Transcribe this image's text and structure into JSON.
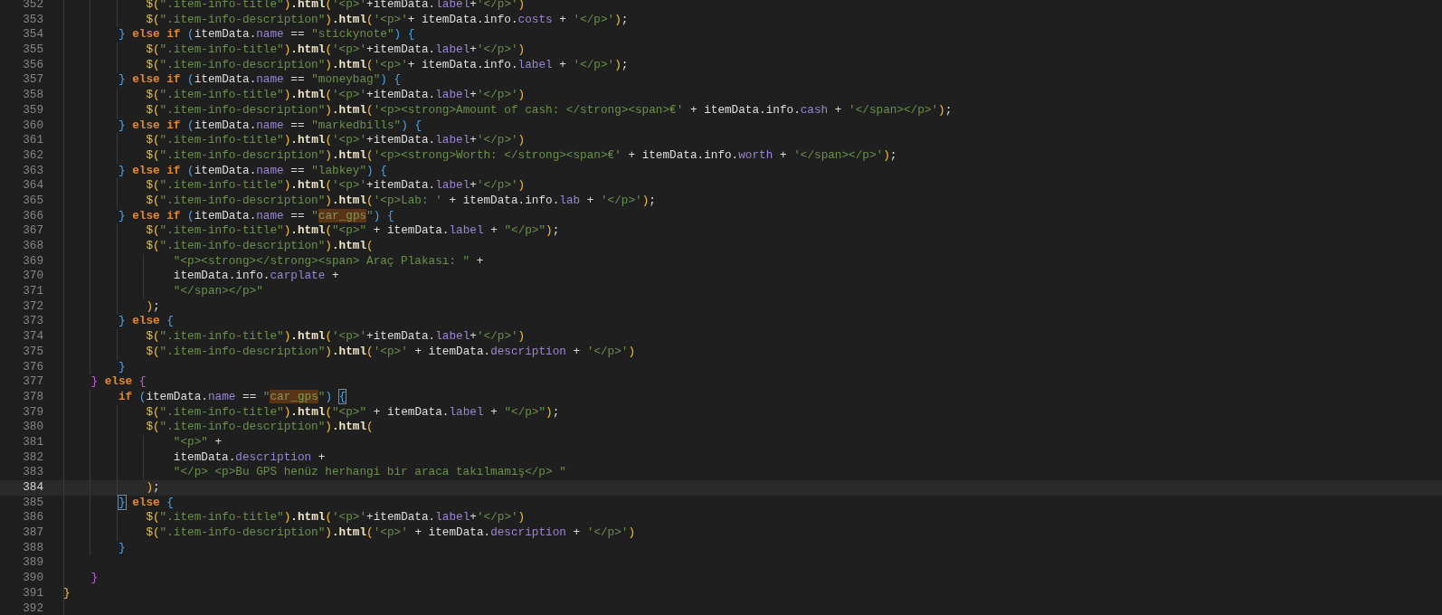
{
  "editor": {
    "lines": [
      {
        "number": "352",
        "current": false,
        "tokens": [
          {
            "text": "            $(",
            "kind": "paren"
          },
          {
            "text": "\".item-info-title\"",
            "kind": "string"
          },
          {
            "text": ")",
            "kind": "paren"
          },
          {
            "text": ".html",
            "kind": "method"
          },
          {
            "text": "(",
            "kind": "paren"
          },
          {
            "text": "'<p>'",
            "kind": "string"
          },
          {
            "text": "+itemData.",
            "kind": "plain"
          },
          {
            "text": "label",
            "kind": "property"
          },
          {
            "text": "+",
            "kind": "plain"
          },
          {
            "text": "'</p>'",
            "kind": "string"
          },
          {
            "text": ")",
            "kind": "paren"
          }
        ]
      },
      {
        "number": "353",
        "current": false,
        "tokens": [
          {
            "text": "            $(",
            "kind": "paren"
          },
          {
            "text": "\".item-info-description\"",
            "kind": "string"
          },
          {
            "text": ")",
            "kind": "paren"
          },
          {
            "text": ".html",
            "kind": "method"
          },
          {
            "text": "(",
            "kind": "paren"
          },
          {
            "text": "'<p>'",
            "kind": "string"
          },
          {
            "text": "+ itemData.info.",
            "kind": "plain"
          },
          {
            "text": "costs",
            "kind": "property"
          },
          {
            "text": " + ",
            "kind": "plain"
          },
          {
            "text": "'</p>'",
            "kind": "string"
          },
          {
            "text": ")",
            "kind": "paren"
          },
          {
            "text": ";",
            "kind": "plain"
          }
        ]
      },
      {
        "number": "354",
        "current": false,
        "tokens": [
          {
            "text": "        }",
            "kind": "brace3"
          },
          {
            "text": " else if ",
            "kind": "keyword"
          },
          {
            "text": "(",
            "kind": "brace3"
          },
          {
            "text": "itemData.",
            "kind": "plain"
          },
          {
            "text": "name",
            "kind": "property"
          },
          {
            "text": " == ",
            "kind": "plain"
          },
          {
            "text": "\"stickynote\"",
            "kind": "string"
          },
          {
            "text": ") {",
            "kind": "brace3"
          }
        ]
      },
      {
        "number": "355",
        "current": false,
        "tokens": [
          {
            "text": "            $(",
            "kind": "paren"
          },
          {
            "text": "\".item-info-title\"",
            "kind": "string"
          },
          {
            "text": ")",
            "kind": "paren"
          },
          {
            "text": ".html",
            "kind": "method"
          },
          {
            "text": "(",
            "kind": "paren"
          },
          {
            "text": "'<p>'",
            "kind": "string"
          },
          {
            "text": "+itemData.",
            "kind": "plain"
          },
          {
            "text": "label",
            "kind": "property"
          },
          {
            "text": "+",
            "kind": "plain"
          },
          {
            "text": "'</p>'",
            "kind": "string"
          },
          {
            "text": ")",
            "kind": "paren"
          }
        ]
      },
      {
        "number": "356",
        "current": false,
        "tokens": [
          {
            "text": "            $(",
            "kind": "paren"
          },
          {
            "text": "\".item-info-description\"",
            "kind": "string"
          },
          {
            "text": ")",
            "kind": "paren"
          },
          {
            "text": ".html",
            "kind": "method"
          },
          {
            "text": "(",
            "kind": "paren"
          },
          {
            "text": "'<p>'",
            "kind": "string"
          },
          {
            "text": "+ itemData.info.",
            "kind": "plain"
          },
          {
            "text": "label",
            "kind": "property"
          },
          {
            "text": " + ",
            "kind": "plain"
          },
          {
            "text": "'</p>'",
            "kind": "string"
          },
          {
            "text": ")",
            "kind": "paren"
          },
          {
            "text": ";",
            "kind": "plain"
          }
        ]
      },
      {
        "number": "357",
        "current": false,
        "tokens": [
          {
            "text": "        }",
            "kind": "brace3"
          },
          {
            "text": " else if ",
            "kind": "keyword"
          },
          {
            "text": "(",
            "kind": "brace3"
          },
          {
            "text": "itemData.",
            "kind": "plain"
          },
          {
            "text": "name",
            "kind": "property"
          },
          {
            "text": " == ",
            "kind": "plain"
          },
          {
            "text": "\"moneybag\"",
            "kind": "string"
          },
          {
            "text": ") {",
            "kind": "brace3"
          }
        ]
      },
      {
        "number": "358",
        "current": false,
        "tokens": [
          {
            "text": "            $(",
            "kind": "paren"
          },
          {
            "text": "\".item-info-title\"",
            "kind": "string"
          },
          {
            "text": ")",
            "kind": "paren"
          },
          {
            "text": ".html",
            "kind": "method"
          },
          {
            "text": "(",
            "kind": "paren"
          },
          {
            "text": "'<p>'",
            "kind": "string"
          },
          {
            "text": "+itemData.",
            "kind": "plain"
          },
          {
            "text": "label",
            "kind": "property"
          },
          {
            "text": "+",
            "kind": "plain"
          },
          {
            "text": "'</p>'",
            "kind": "string"
          },
          {
            "text": ")",
            "kind": "paren"
          }
        ]
      },
      {
        "number": "359",
        "current": false,
        "tokens": [
          {
            "text": "            $(",
            "kind": "paren"
          },
          {
            "text": "\".item-info-description\"",
            "kind": "string"
          },
          {
            "text": ")",
            "kind": "paren"
          },
          {
            "text": ".html",
            "kind": "method"
          },
          {
            "text": "(",
            "kind": "paren"
          },
          {
            "text": "'<p><strong>Amount of cash: </strong><span>€'",
            "kind": "string"
          },
          {
            "text": " + itemData.info.",
            "kind": "plain"
          },
          {
            "text": "cash",
            "kind": "property"
          },
          {
            "text": " + ",
            "kind": "plain"
          },
          {
            "text": "'</span></p>'",
            "kind": "string"
          },
          {
            "text": ")",
            "kind": "paren"
          },
          {
            "text": ";",
            "kind": "plain"
          }
        ]
      },
      {
        "number": "360",
        "current": false,
        "tokens": [
          {
            "text": "        }",
            "kind": "brace3"
          },
          {
            "text": " else if ",
            "kind": "keyword"
          },
          {
            "text": "(",
            "kind": "brace3"
          },
          {
            "text": "itemData.",
            "kind": "plain"
          },
          {
            "text": "name",
            "kind": "property"
          },
          {
            "text": " == ",
            "kind": "plain"
          },
          {
            "text": "\"markedbills\"",
            "kind": "string"
          },
          {
            "text": ") {",
            "kind": "brace3"
          }
        ]
      },
      {
        "number": "361",
        "current": false,
        "tokens": [
          {
            "text": "            $(",
            "kind": "paren"
          },
          {
            "text": "\".item-info-title\"",
            "kind": "string"
          },
          {
            "text": ")",
            "kind": "paren"
          },
          {
            "text": ".html",
            "kind": "method"
          },
          {
            "text": "(",
            "kind": "paren"
          },
          {
            "text": "'<p>'",
            "kind": "string"
          },
          {
            "text": "+itemData.",
            "kind": "plain"
          },
          {
            "text": "label",
            "kind": "property"
          },
          {
            "text": "+",
            "kind": "plain"
          },
          {
            "text": "'</p>'",
            "kind": "string"
          },
          {
            "text": ")",
            "kind": "paren"
          }
        ]
      },
      {
        "number": "362",
        "current": false,
        "tokens": [
          {
            "text": "            $(",
            "kind": "paren"
          },
          {
            "text": "\".item-info-description\"",
            "kind": "string"
          },
          {
            "text": ")",
            "kind": "paren"
          },
          {
            "text": ".html",
            "kind": "method"
          },
          {
            "text": "(",
            "kind": "paren"
          },
          {
            "text": "'<p><strong>Worth: </strong><span>€'",
            "kind": "string"
          },
          {
            "text": " + itemData.info.",
            "kind": "plain"
          },
          {
            "text": "worth",
            "kind": "property"
          },
          {
            "text": " + ",
            "kind": "plain"
          },
          {
            "text": "'</span></p>'",
            "kind": "string"
          },
          {
            "text": ")",
            "kind": "paren"
          },
          {
            "text": ";",
            "kind": "plain"
          }
        ]
      },
      {
        "number": "363",
        "current": false,
        "tokens": [
          {
            "text": "        }",
            "kind": "brace3"
          },
          {
            "text": " else if ",
            "kind": "keyword"
          },
          {
            "text": "(",
            "kind": "brace3"
          },
          {
            "text": "itemData.",
            "kind": "plain"
          },
          {
            "text": "name",
            "kind": "property"
          },
          {
            "text": " == ",
            "kind": "plain"
          },
          {
            "text": "\"labkey\"",
            "kind": "string"
          },
          {
            "text": ") {",
            "kind": "brace3"
          }
        ]
      },
      {
        "number": "364",
        "current": false,
        "tokens": [
          {
            "text": "            $(",
            "kind": "paren"
          },
          {
            "text": "\".item-info-title\"",
            "kind": "string"
          },
          {
            "text": ")",
            "kind": "paren"
          },
          {
            "text": ".html",
            "kind": "method"
          },
          {
            "text": "(",
            "kind": "paren"
          },
          {
            "text": "'<p>'",
            "kind": "string"
          },
          {
            "text": "+itemData.",
            "kind": "plain"
          },
          {
            "text": "label",
            "kind": "property"
          },
          {
            "text": "+",
            "kind": "plain"
          },
          {
            "text": "'</p>'",
            "kind": "string"
          },
          {
            "text": ")",
            "kind": "paren"
          }
        ]
      },
      {
        "number": "365",
        "current": false,
        "tokens": [
          {
            "text": "            $(",
            "kind": "paren"
          },
          {
            "text": "\".item-info-description\"",
            "kind": "string"
          },
          {
            "text": ")",
            "kind": "paren"
          },
          {
            "text": ".html",
            "kind": "method"
          },
          {
            "text": "(",
            "kind": "paren"
          },
          {
            "text": "'<p>Lab: '",
            "kind": "string"
          },
          {
            "text": " + itemData.info.",
            "kind": "plain"
          },
          {
            "text": "lab",
            "kind": "property"
          },
          {
            "text": " + ",
            "kind": "plain"
          },
          {
            "text": "'</p>'",
            "kind": "string"
          },
          {
            "text": ")",
            "kind": "paren"
          },
          {
            "text": ";",
            "kind": "plain"
          }
        ]
      },
      {
        "number": "366",
        "current": false,
        "tokens": [
          {
            "text": "        }",
            "kind": "brace3"
          },
          {
            "text": " else if ",
            "kind": "keyword"
          },
          {
            "text": "(",
            "kind": "brace3"
          },
          {
            "text": "itemData.",
            "kind": "plain"
          },
          {
            "text": "name",
            "kind": "property"
          },
          {
            "text": " == ",
            "kind": "plain"
          },
          {
            "text": "\"",
            "kind": "string"
          },
          {
            "text": "car_gps",
            "kind": "highlight"
          },
          {
            "text": "\"",
            "kind": "string"
          },
          {
            "text": ") {",
            "kind": "brace3"
          }
        ]
      },
      {
        "number": "367",
        "current": false,
        "tokens": [
          {
            "text": "            $(",
            "kind": "paren"
          },
          {
            "text": "\".item-info-title\"",
            "kind": "string"
          },
          {
            "text": ")",
            "kind": "paren"
          },
          {
            "text": ".html",
            "kind": "method"
          },
          {
            "text": "(",
            "kind": "paren"
          },
          {
            "text": "\"<p>\"",
            "kind": "string"
          },
          {
            "text": " + itemData.",
            "kind": "plain"
          },
          {
            "text": "label",
            "kind": "property"
          },
          {
            "text": " + ",
            "kind": "plain"
          },
          {
            "text": "\"</p>\"",
            "kind": "string"
          },
          {
            "text": ")",
            "kind": "paren"
          },
          {
            "text": ";",
            "kind": "plain"
          }
        ]
      },
      {
        "number": "368",
        "current": false,
        "tokens": [
          {
            "text": "            $(",
            "kind": "paren"
          },
          {
            "text": "\".item-info-description\"",
            "kind": "string"
          },
          {
            "text": ")",
            "kind": "paren"
          },
          {
            "text": ".html",
            "kind": "method"
          },
          {
            "text": "(",
            "kind": "paren"
          }
        ]
      },
      {
        "number": "369",
        "current": false,
        "tokens": [
          {
            "text": "                \"<p><strong></strong><span> Araç Plakası: \"",
            "kind": "string"
          },
          {
            "text": " +",
            "kind": "plain"
          }
        ]
      },
      {
        "number": "370",
        "current": false,
        "tokens": [
          {
            "text": "                itemData.info.",
            "kind": "plain"
          },
          {
            "text": "carplate",
            "kind": "property"
          },
          {
            "text": " +",
            "kind": "plain"
          }
        ]
      },
      {
        "number": "371",
        "current": false,
        "tokens": [
          {
            "text": "                \"</span></p>\"",
            "kind": "string"
          }
        ]
      },
      {
        "number": "372",
        "current": false,
        "tokens": [
          {
            "text": "            )",
            "kind": "paren"
          },
          {
            "text": ";",
            "kind": "plain"
          }
        ]
      },
      {
        "number": "373",
        "current": false,
        "tokens": [
          {
            "text": "        }",
            "kind": "brace3"
          },
          {
            "text": " else ",
            "kind": "keyword"
          },
          {
            "text": "{",
            "kind": "brace3"
          }
        ]
      },
      {
        "number": "374",
        "current": false,
        "tokens": [
          {
            "text": "            $(",
            "kind": "paren"
          },
          {
            "text": "\".item-info-title\"",
            "kind": "string"
          },
          {
            "text": ")",
            "kind": "paren"
          },
          {
            "text": ".html",
            "kind": "method"
          },
          {
            "text": "(",
            "kind": "paren"
          },
          {
            "text": "'<p>'",
            "kind": "string"
          },
          {
            "text": "+itemData.",
            "kind": "plain"
          },
          {
            "text": "label",
            "kind": "property"
          },
          {
            "text": "+",
            "kind": "plain"
          },
          {
            "text": "'</p>'",
            "kind": "string"
          },
          {
            "text": ")",
            "kind": "paren"
          }
        ]
      },
      {
        "number": "375",
        "current": false,
        "tokens": [
          {
            "text": "            $(",
            "kind": "paren"
          },
          {
            "text": "\".item-info-description\"",
            "kind": "string"
          },
          {
            "text": ")",
            "kind": "paren"
          },
          {
            "text": ".html",
            "kind": "method"
          },
          {
            "text": "(",
            "kind": "paren"
          },
          {
            "text": "'<p>'",
            "kind": "string"
          },
          {
            "text": " + itemData.",
            "kind": "plain"
          },
          {
            "text": "description",
            "kind": "property"
          },
          {
            "text": " + ",
            "kind": "plain"
          },
          {
            "text": "'</p>'",
            "kind": "string"
          },
          {
            "text": ")",
            "kind": "paren"
          }
        ]
      },
      {
        "number": "376",
        "current": false,
        "tokens": [
          {
            "text": "        }",
            "kind": "brace3"
          }
        ]
      },
      {
        "number": "377",
        "current": false,
        "tokens": [
          {
            "text": "    }",
            "kind": "brace2"
          },
          {
            "text": " else ",
            "kind": "keyword"
          },
          {
            "text": "{",
            "kind": "brace2"
          }
        ]
      },
      {
        "number": "378",
        "current": false,
        "tokens": [
          {
            "text": "        if ",
            "kind": "keyword"
          },
          {
            "text": "(",
            "kind": "brace3"
          },
          {
            "text": "itemData.",
            "kind": "plain"
          },
          {
            "text": "name",
            "kind": "property"
          },
          {
            "text": " == ",
            "kind": "plain"
          },
          {
            "text": "\"",
            "kind": "string"
          },
          {
            "text": "car_gps",
            "kind": "highlight"
          },
          {
            "text": "\"",
            "kind": "string"
          },
          {
            "text": ") ",
            "kind": "brace3"
          },
          {
            "text": "{",
            "kind": "matched"
          }
        ]
      },
      {
        "number": "379",
        "current": false,
        "tokens": [
          {
            "text": "            $(",
            "kind": "paren"
          },
          {
            "text": "\".item-info-title\"",
            "kind": "string"
          },
          {
            "text": ")",
            "kind": "paren"
          },
          {
            "text": ".html",
            "kind": "method"
          },
          {
            "text": "(",
            "kind": "paren"
          },
          {
            "text": "\"<p>\"",
            "kind": "string"
          },
          {
            "text": " + itemData.",
            "kind": "plain"
          },
          {
            "text": "label",
            "kind": "property"
          },
          {
            "text": " + ",
            "kind": "plain"
          },
          {
            "text": "\"</p>\"",
            "kind": "string"
          },
          {
            "text": ")",
            "kind": "paren"
          },
          {
            "text": ";",
            "kind": "plain"
          }
        ]
      },
      {
        "number": "380",
        "current": false,
        "tokens": [
          {
            "text": "            $(",
            "kind": "paren"
          },
          {
            "text": "\".item-info-description\"",
            "kind": "string"
          },
          {
            "text": ")",
            "kind": "paren"
          },
          {
            "text": ".html",
            "kind": "method"
          },
          {
            "text": "(",
            "kind": "paren"
          }
        ]
      },
      {
        "number": "381",
        "current": false,
        "tokens": [
          {
            "text": "                \"<p>\"",
            "kind": "string"
          },
          {
            "text": " +",
            "kind": "plain"
          }
        ]
      },
      {
        "number": "382",
        "current": false,
        "tokens": [
          {
            "text": "                itemData.",
            "kind": "plain"
          },
          {
            "text": "description",
            "kind": "property"
          },
          {
            "text": " +",
            "kind": "plain"
          }
        ]
      },
      {
        "number": "383",
        "current": false,
        "tokens": [
          {
            "text": "                \"</p> <p>Bu GPS henüz herhangi bir araca takılmamış</p> \"",
            "kind": "string"
          }
        ]
      },
      {
        "number": "384",
        "current": true,
        "tokens": [
          {
            "text": "            )",
            "kind": "paren"
          },
          {
            "text": ";",
            "kind": "plain"
          }
        ]
      },
      {
        "number": "385",
        "current": false,
        "tokens": [
          {
            "text": "        }",
            "kind": "matched"
          },
          {
            "text": " else ",
            "kind": "keyword"
          },
          {
            "text": "{",
            "kind": "brace3"
          }
        ]
      },
      {
        "number": "386",
        "current": false,
        "tokens": [
          {
            "text": "            $(",
            "kind": "paren"
          },
          {
            "text": "\".item-info-title\"",
            "kind": "string"
          },
          {
            "text": ")",
            "kind": "paren"
          },
          {
            "text": ".html",
            "kind": "method"
          },
          {
            "text": "(",
            "kind": "paren"
          },
          {
            "text": "'<p>'",
            "kind": "string"
          },
          {
            "text": "+itemData.",
            "kind": "plain"
          },
          {
            "text": "label",
            "kind": "property"
          },
          {
            "text": "+",
            "kind": "plain"
          },
          {
            "text": "'</p>'",
            "kind": "string"
          },
          {
            "text": ")",
            "kind": "paren"
          }
        ]
      },
      {
        "number": "387",
        "current": false,
        "tokens": [
          {
            "text": "            $(",
            "kind": "paren"
          },
          {
            "text": "\".item-info-description\"",
            "kind": "string"
          },
          {
            "text": ")",
            "kind": "paren"
          },
          {
            "text": ".html",
            "kind": "method"
          },
          {
            "text": "(",
            "kind": "paren"
          },
          {
            "text": "'<p>'",
            "kind": "string"
          },
          {
            "text": " + itemData.",
            "kind": "plain"
          },
          {
            "text": "description",
            "kind": "property"
          },
          {
            "text": " + ",
            "kind": "plain"
          },
          {
            "text": "'</p>'",
            "kind": "string"
          },
          {
            "text": ")",
            "kind": "paren"
          }
        ]
      },
      {
        "number": "388",
        "current": false,
        "tokens": [
          {
            "text": "        }",
            "kind": "brace3"
          }
        ]
      },
      {
        "number": "389",
        "current": false
      },
      {
        "number": "390",
        "current": false,
        "tokens": [
          {
            "text": "    }",
            "kind": "brace2"
          }
        ]
      },
      {
        "number": "391",
        "current": false,
        "tokens": [
          {
            "text": "}",
            "kind": "brace1"
          }
        ]
      },
      {
        "number": "392",
        "current": false
      }
    ]
  }
}
